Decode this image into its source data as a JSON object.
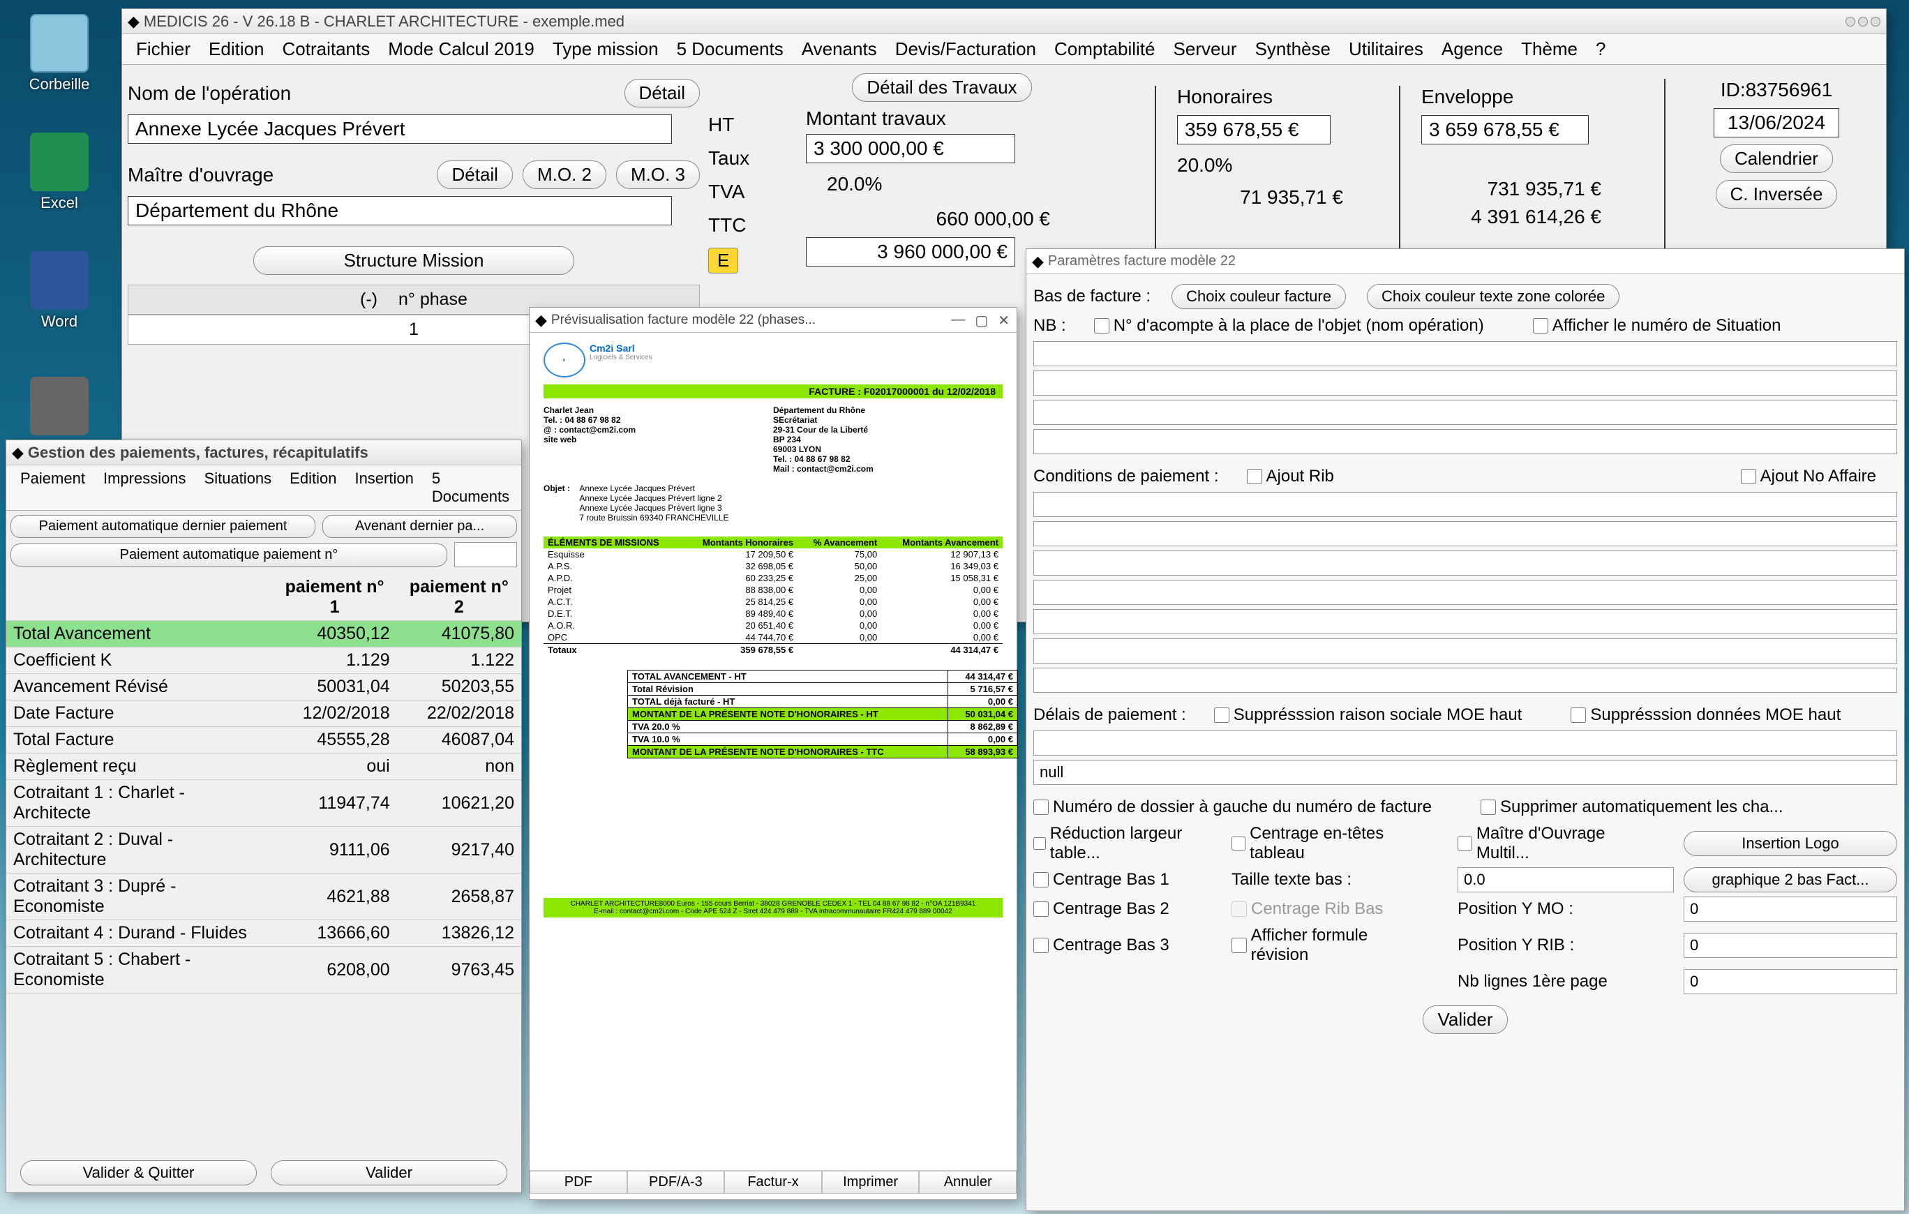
{
  "desktop": {
    "icons": [
      "Corbeille",
      "Excel",
      "Word"
    ]
  },
  "main_window": {
    "title": "MEDICIS 26  -  V 26.18 B  -  CHARLET ARCHITECTURE  -  exemple.med",
    "menu": [
      "Fichier",
      "Edition",
      "Cotraitants",
      "Mode Calcul 2019",
      "Type mission",
      "5 Documents",
      "Avenants",
      "Devis/Facturation",
      "Comptabilité",
      "Serveur",
      "Synthèse",
      "Utilitaires",
      "Agence",
      "Thème",
      "?"
    ],
    "op_label": "Nom de l'opération",
    "detail_btn": "Détail",
    "op_value": "Annexe Lycée Jacques Prévert",
    "mo_label": "Maître d'ouvrage",
    "mo2_btn": "M.O. 2",
    "mo3_btn": "M.O. 3",
    "mo_value": "Département du Rhône",
    "structure_mission": "Structure Mission",
    "phase_header_minus": "(-)",
    "phase_header_num": "n° phase",
    "phase_value": "1",
    "ht_label": "HT",
    "taux_label": "Taux",
    "tva_label": "TVA",
    "ttc_label": "TTC",
    "e_label": "E",
    "detail_travaux_btn": "Détail des Travaux",
    "montant_travaux_label": "Montant travaux",
    "montant_travaux_value": "3 300 000,00 €",
    "taux_value": "20.0%",
    "tva_value": "660 000,00 €",
    "ttc_value": "3 960 000,00 €",
    "honoraires_label": "Honoraires",
    "honoraires_value": "359 678,55 €",
    "honoraires_pct": "20.0%",
    "honoraires_tva": "71 935,71 €",
    "enveloppe_label": "Enveloppe",
    "enveloppe_value": "3 659 678,55 €",
    "enveloppe_tva": "731 935,71 €",
    "enveloppe_ttc": "4 391 614,26 €",
    "id_label": "ID:83756961",
    "date_value": "13/06/2024",
    "calendrier_btn": "Calendrier",
    "cinv_btn": "C. Inversée"
  },
  "payments_window": {
    "title": "Gestion des paiements, factures, récapitulatifs",
    "menu": [
      "Paiement",
      "Impressions",
      "Situations",
      "Edition",
      "Insertion",
      "5 Documents"
    ],
    "btns": {
      "auto_last": "Paiement automatique dernier paiement",
      "avenant": "Avenant dernier pa...",
      "auto_num": "Paiement automatique paiement n°",
      "valider_quitter": "Valider & Quitter",
      "valider": "Valider"
    },
    "cols": [
      "paiement n° 1",
      "paiement n° 2"
    ],
    "rows": [
      {
        "label": "Total Avancement",
        "v1": "40350,12",
        "v2": "41075,80",
        "hl": true
      },
      {
        "label": "Coefficient K",
        "v1": "1.129",
        "v2": "1.122"
      },
      {
        "label": "Avancement Révisé",
        "v1": "50031,04",
        "v2": "50203,55"
      },
      {
        "label": "Date Facture",
        "v1": "12/02/2018",
        "v2": "22/02/2018"
      },
      {
        "label": "Total Facture",
        "v1": "45555,28",
        "v2": "46087,04"
      },
      {
        "label": "Règlement reçu",
        "v1": "oui",
        "v2": "non"
      },
      {
        "label": "Cotraitant 1 : Charlet - Architecte",
        "v1": "11947,74",
        "v2": "10621,20"
      },
      {
        "label": "Cotraitant 2 : Duval - Architecture",
        "v1": "9111,06",
        "v2": "9217,40"
      },
      {
        "label": "Cotraitant 3 : Dupré - Economiste",
        "v1": "4621,88",
        "v2": "2658,87"
      },
      {
        "label": "Cotraitant 4 : Durand - Fluides",
        "v1": "13666,60",
        "v2": "13826,12"
      },
      {
        "label": "Cotraitant 5 : Chabert - Economiste",
        "v1": "6208,00",
        "v2": "9763,45"
      }
    ]
  },
  "preview_window": {
    "title": "Prévisualisation facture modèle 22 (phases...",
    "header": {
      "company": "Cm2i Sarl",
      "subtitle": "Logiciels & Services",
      "facture_no": "FACTURE : F02017000001 du 12/02/2018",
      "name": "Charlet Jean",
      "tel": "Tel. : 04 88 67 98 82",
      "email": "@ : contact@cm2i.com",
      "site": "site web",
      "addr1": "Département du Rhône",
      "addr2": "SEcrétariat",
      "addr3": "29-31 Cour de la Liberté",
      "addr4": "BP 234",
      "addr5": "69003 LYON",
      "addr6": "Tel. : 04 88 67 98 82",
      "addr7": "Mail : contact@cm2i.com",
      "objet_lbl": "Objet :",
      "objet1": "Annexe Lycée Jacques Prévert",
      "objet2": "Annexe Lycée Jacques Prévert ligne 2",
      "objet3": "Annexe Lycée Jacques Prévert ligne 3",
      "objet4": "7 route Bruissin 69340 FRANCHEVILLE"
    },
    "columns": [
      "ÉLÉMENTS DE MISSIONS",
      "Montants Honoraires",
      "% Avancement",
      "Montants Avancement"
    ],
    "items": [
      {
        "n": "Esquisse",
        "h": "17 209,50 €",
        "p": "75,00",
        "a": "12 907,13 €"
      },
      {
        "n": "A.P.S.",
        "h": "32 698,05 €",
        "p": "50,00",
        "a": "16 349,03 €"
      },
      {
        "n": "A.P.D.",
        "h": "60 233,25 €",
        "p": "25,00",
        "a": "15 058,31 €"
      },
      {
        "n": "Projet",
        "h": "88 838,00 €",
        "p": "0,00",
        "a": "0,00 €"
      },
      {
        "n": "A.C.T.",
        "h": "25 814,25 €",
        "p": "0,00",
        "a": "0,00 €"
      },
      {
        "n": "D.E.T.",
        "h": "89 489,40 €",
        "p": "0,00",
        "a": "0,00 €"
      },
      {
        "n": "A.O.R.",
        "h": "20 651,40 €",
        "p": "0,00",
        "a": "0,00 €"
      },
      {
        "n": "OPC",
        "h": "44 744,70 €",
        "p": "0,00",
        "a": "0,00 €"
      }
    ],
    "totaux_label": "Totaux",
    "totaux_h": "359 678,55 €",
    "totaux_a": "44 314,47 €",
    "summary": [
      {
        "l": "TOTAL AVANCEMENT - HT",
        "v": "44 314,47 €"
      },
      {
        "l": "Total Révision",
        "v": "5 716,57 €"
      },
      {
        "l": "TOTAL déjà facturé - HT",
        "v": "0,00 €"
      },
      {
        "l": "MONTANT DE LA PRÉSENTE NOTE D'HONORAIRES - HT",
        "v": "50 031,04 €",
        "hl": true
      },
      {
        "l": "TVA 20.0 %",
        "v": "8 862,89 €"
      },
      {
        "l": "TVA 10.0 %",
        "v": "0,00 €"
      },
      {
        "l": "MONTANT DE LA PRÉSENTE NOTE D'HONORAIRES - TTC",
        "v": "58 893,93 €",
        "hl": true
      }
    ],
    "footer1": "CHARLET ARCHITECTURE8000 Euros - 155 cours Berriat - 38028 GRENOBLE CEDEX 1 - TEL 04 88 67 98 82 - n°OA 121B9341",
    "footer2": "E-mail : contact@cm2i.com - Code APE 524 Z - Siret 424 479 889 - TVA intracommunautaire FR424 479 889 00042",
    "buttons": [
      "PDF",
      "PDF/A-3",
      "Factur-x",
      "Imprimer",
      "Annuler"
    ]
  },
  "params_window": {
    "title": "Paramètres facture modèle 22",
    "bas_facture": "Bas de facture :",
    "choix_couleur": "Choix couleur facture",
    "choix_couleur_txt": "Choix couleur texte zone colorée",
    "nb": "NB :",
    "chk_acompte": "N° d'acompte à la place de l'objet (nom opération)",
    "chk_situation": "Afficher le numéro de Situation",
    "cond_paiement": "Conditions de paiement :",
    "chk_rib": "Ajout Rib",
    "chk_affaire": "Ajout No Affaire",
    "delais": "Délais de paiement :",
    "chk_supp_moe_haut": "Supprésssion raison sociale MOE haut",
    "chk_supp_moe_haut2": "Supprésssion données MOE haut",
    "null_value": "null",
    "chk_dossier_gauche": "Numéro de dossier à gauche du numéro de facture",
    "chk_supprimer_auto": "Supprimer automatiquement les cha...",
    "chk_red_largeur": "Réduction largeur table...",
    "chk_centrage_entetes": "Centrage en-têtes tableau",
    "chk_mo_multi": "Maître d'Ouvrage Multil...",
    "insertion_logo": "Insertion Logo",
    "chk_bas1": "Centrage Bas 1",
    "taille_texte": "Taille texte bas :",
    "taille_val": "0.0",
    "graphique": "graphique 2 bas Fact...",
    "chk_bas2": "Centrage Bas 2",
    "chk_centrage_rib": "Centrage Rib Bas",
    "pos_mo": "Position Y MO :",
    "pos_mo_val": "0",
    "chk_bas3": "Centrage Bas 3",
    "chk_formule": "Afficher formule révision",
    "pos_rib": "Position Y RIB :",
    "pos_rib_val": "0",
    "nb_lignes": "Nb lignes 1ère page",
    "nb_lignes_val": "0",
    "valider": "Valider"
  }
}
